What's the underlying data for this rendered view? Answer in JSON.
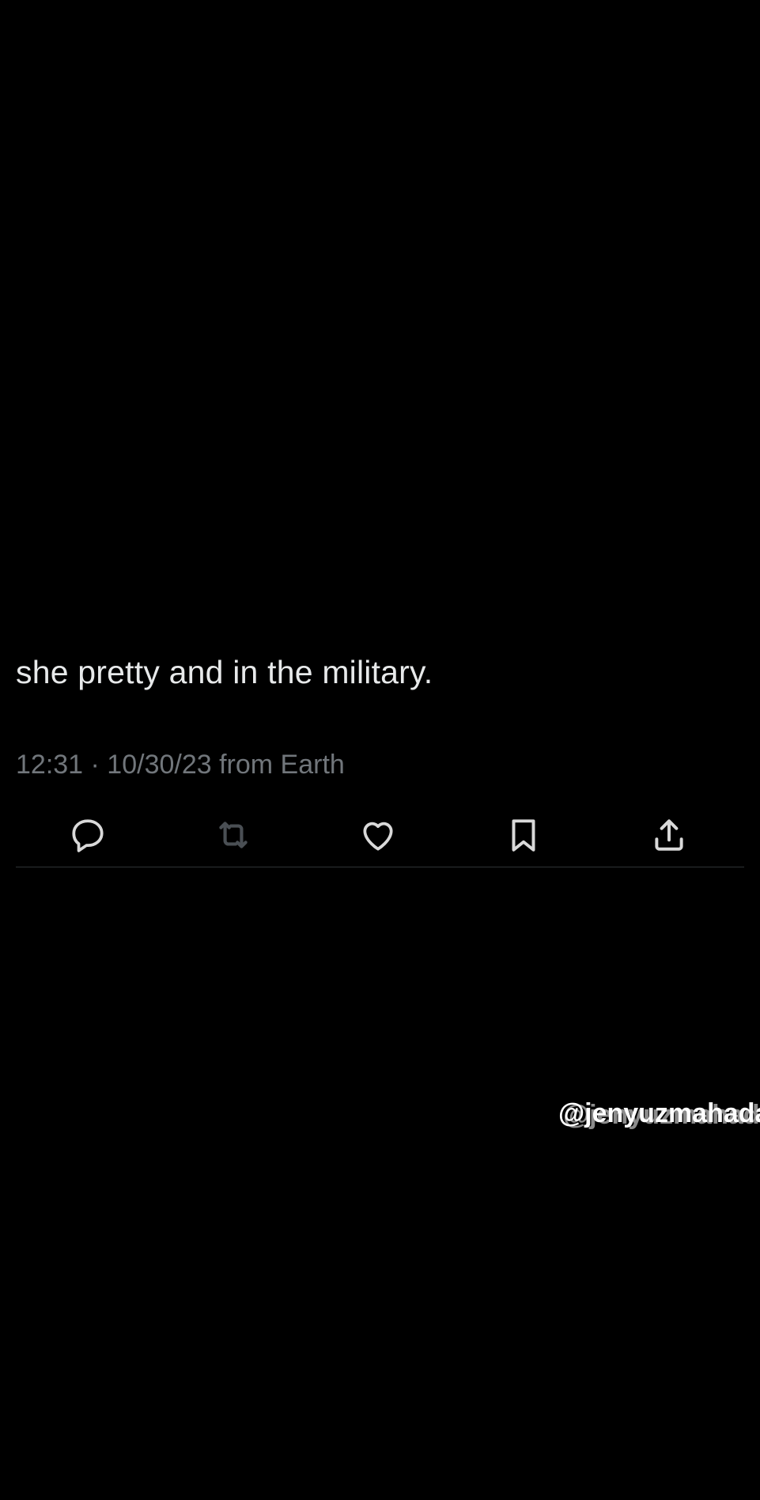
{
  "tweet": {
    "text": "she pretty and in the military.",
    "timestamp": "12:31 · 10/30/23 from Earth"
  },
  "actions": [
    {
      "name": "reply",
      "icon": "reply-icon"
    },
    {
      "name": "retweet",
      "icon": "retweet-icon"
    },
    {
      "name": "like",
      "icon": "heart-icon"
    },
    {
      "name": "bookmark",
      "icon": "bookmark-icon"
    },
    {
      "name": "share",
      "icon": "share-icon"
    }
  ],
  "watermark": {
    "text": "@jenyuzmahaday"
  },
  "colors": {
    "background": "#000000",
    "text": "#e7e9ea",
    "secondary": "#71767b",
    "icon": "#d9d9d9",
    "retweet_icon": "#4a4f54",
    "divider": "#2f3336"
  }
}
